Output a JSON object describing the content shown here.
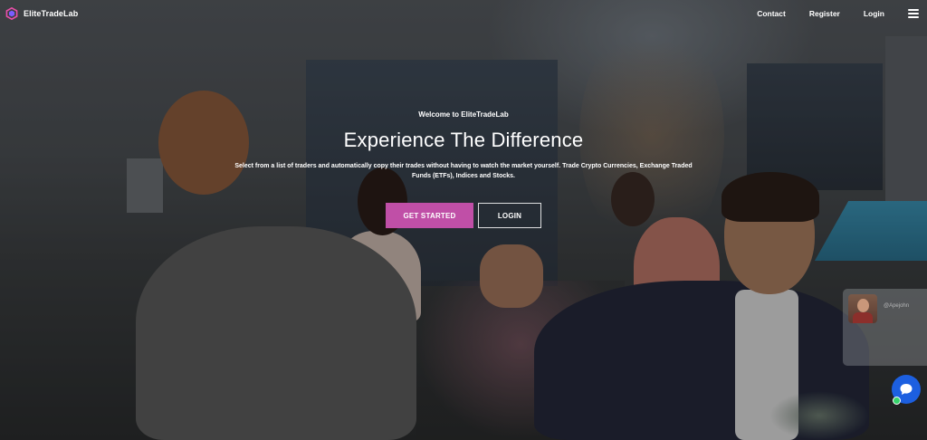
{
  "brand": {
    "name": "EliteTradeLab",
    "logo_icon": "hexagon-logo-icon",
    "logo_colors": [
      "#e84fa8",
      "#7b5cff"
    ]
  },
  "nav": {
    "links": [
      "Contact",
      "Register",
      "Login"
    ],
    "menu_icon": "hamburger-menu-icon"
  },
  "hero": {
    "eyebrow": "Welcome to EliteTradeLab",
    "title": "Experience The Difference",
    "subtitle": "Select from a list of traders and automatically copy their trades without having to watch the market yourself. Trade Crypto Currencies, Exchange Traded Funds (ETFs), Indices and Stocks.",
    "primary_button": "GET STARTED",
    "secondary_button": "LOGIN"
  },
  "widgets": {
    "video_chat_handle": "@Apejohn",
    "chat_icon": "chat-bubble-icon",
    "online_indicator": "online-status-dot"
  },
  "colors": {
    "primary_button": "#c04fa7",
    "chat_button": "#1c5fe0",
    "online": "#35d36a"
  }
}
